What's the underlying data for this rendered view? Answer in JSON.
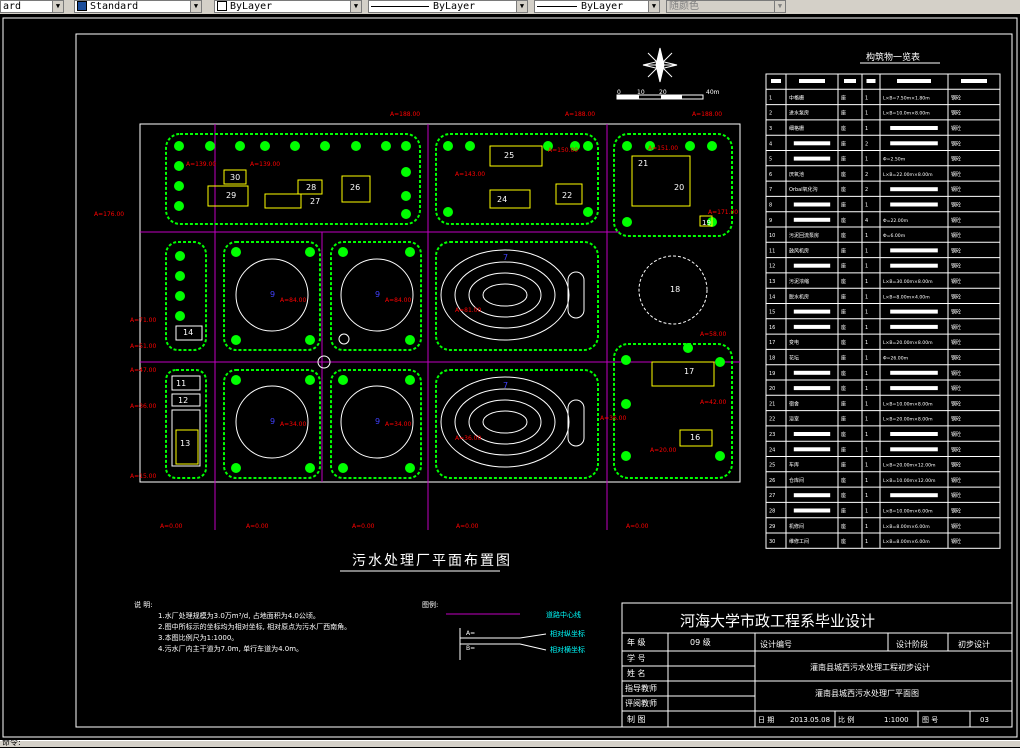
{
  "toolbar": {
    "layer_value": "ard",
    "textstyle_value": "Standard",
    "color_value": "ByLayer",
    "linetype_value": "ByLayer",
    "lineweight_value": "ByLayer",
    "plotstyle_value": "随颜色"
  },
  "drawing": {
    "north_arrow_scale": [
      "0",
      "10",
      "20",
      "40m"
    ],
    "plan_title": "污水处理厂平面布置图",
    "table_title": "构筑物一览表",
    "notes_title": "说 明:",
    "notes": [
      "1.水厂处理规模为3.0万m³/d, 占地面积为4.0公顷。",
      "2.图中所标示的坐标均为相对坐标, 相对原点为污水厂西南角。",
      "3.本图比例尺为1:1000。",
      "4.污水厂内主干道为7.0m, 单行车道为4.0m。"
    ],
    "legend_title": "图例:",
    "legend": [
      "道路中心线",
      "相对纵坐标",
      "相对横坐标"
    ],
    "legend_prefix": [
      "A=",
      "B="
    ],
    "unit_numbers": [
      "1",
      "2",
      "3",
      "4",
      "5",
      "6",
      "7",
      "8",
      "9",
      "10",
      "11",
      "12",
      "13",
      "14",
      "15",
      "16",
      "17",
      "18",
      "19",
      "20",
      "21",
      "22",
      "23",
      "24",
      "25",
      "26",
      "27",
      "28",
      "29",
      "30"
    ],
    "table_rows": [
      [
        "1",
        "中格栅",
        "座",
        "1",
        "L×B=7.50m×1.80m",
        "钢砼"
      ],
      [
        "2",
        "进水泵房",
        "座",
        "1",
        "L×B=10.0m×8.00m",
        "钢砼"
      ],
      [
        "3",
        "细格栅",
        "座",
        "1",
        "",
        "钢砼"
      ],
      [
        "4",
        "",
        "座",
        "2",
        "",
        "钢砼"
      ],
      [
        "5",
        "",
        "座",
        "1",
        "Φ=2.50m",
        "钢砼"
      ],
      [
        "6",
        "厌氧池",
        "座",
        "2",
        "L×B=22.00m×8.00m",
        "钢砼"
      ],
      [
        "7",
        "Orbal氧化沟",
        "座",
        "2",
        "",
        "钢砼"
      ],
      [
        "8",
        "",
        "座",
        "1",
        "",
        "钢砼"
      ],
      [
        "9",
        "",
        "座",
        "4",
        "Φ=22.00m",
        "钢砼"
      ],
      [
        "10",
        "污泥回流泵房",
        "座",
        "1",
        "Φ=6.00m",
        "钢砼"
      ],
      [
        "11",
        "鼓风机房",
        "座",
        "1",
        "",
        "钢砼"
      ],
      [
        "12",
        "",
        "座",
        "1",
        "",
        "钢砼"
      ],
      [
        "13",
        "污泥浓缩",
        "座",
        "1",
        "L×B=30.00m×8.00m",
        "钢砼"
      ],
      [
        "14",
        "脱水机房",
        "座",
        "1",
        "L×B=8.00m×4.00m",
        "钢砼"
      ],
      [
        "15",
        "",
        "座",
        "1",
        "",
        "钢砼"
      ],
      [
        "16",
        "",
        "座",
        "1",
        "",
        "钢砼"
      ],
      [
        "17",
        "变电",
        "座",
        "1",
        "L×B=20.00m×8.00m",
        "钢砼"
      ],
      [
        "18",
        "花坛",
        "座",
        "1",
        "Φ=26.00m",
        "钢砼"
      ],
      [
        "19",
        "",
        "座",
        "1",
        "",
        "钢砼"
      ],
      [
        "20",
        "",
        "座",
        "1",
        "",
        "钢砼"
      ],
      [
        "21",
        "宿舍",
        "座",
        "1",
        "L×B=10.00m×8.00m",
        "钢砼"
      ],
      [
        "22",
        "浴室",
        "座",
        "1",
        "L×B=20.00m×8.00m",
        "钢砼"
      ],
      [
        "23",
        "",
        "座",
        "1",
        "",
        "钢砼"
      ],
      [
        "24",
        "",
        "座",
        "1",
        "",
        "钢砼"
      ],
      [
        "25",
        "车库",
        "座",
        "1",
        "L×B=20.00m×12.00m",
        "钢砼"
      ],
      [
        "26",
        "仓库间",
        "座",
        "1",
        "L×B=10.00m×12.00m",
        "钢砼"
      ],
      [
        "27",
        "",
        "座",
        "1",
        "",
        "钢砼"
      ],
      [
        "28",
        "",
        "座",
        "1",
        "L×B=10.00m×6.00m",
        "钢砼"
      ],
      [
        "29",
        "机修间",
        "座",
        "1",
        "L×B=8.00m×6.00m",
        "钢砼"
      ],
      [
        "30",
        "维修工间",
        "座",
        "1",
        "L×B=8.00m×6.00m",
        "钢砼"
      ]
    ]
  },
  "title_block": {
    "school": "河海大学市政工程系毕业设计",
    "labels": [
      "年  级",
      "学  号",
      "姓  名",
      "指导教师",
      "评阅教师",
      "制  图"
    ],
    "grade_value": "09  级",
    "design_no_label": "设计编号",
    "stage_label": "设计阶段",
    "stage_value": "初步设计",
    "project_name": "灌南县城西污水处理工程初步设计",
    "drawing_name": "灌南县城西污水处理厂平面图",
    "date_label": "日  期",
    "date_value": "2013.05.08",
    "scale_label": "比  例",
    "scale_value": "1:1000",
    "sheet_label": "图  号",
    "sheet_value": "03"
  },
  "status": {
    "text": "命令:"
  }
}
